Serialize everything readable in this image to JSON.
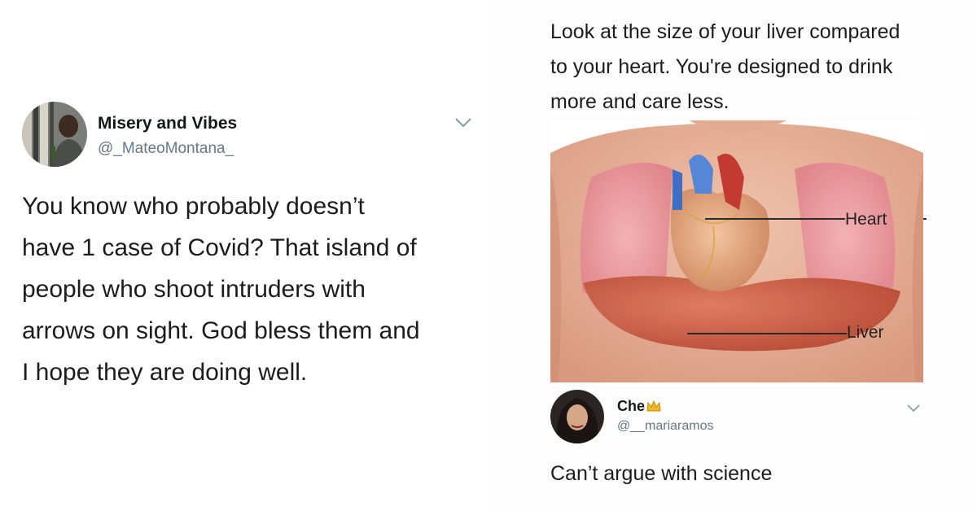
{
  "left_tweet": {
    "display_name": "Misery and Vibes",
    "handle": "@_MateoMontana_",
    "text_lines": [
      "You know who probably doesn’t",
      "have 1 case of Covid? That island of",
      "people who shoot intruders with",
      "arrows on sight. God bless them and",
      "I hope they are doing well."
    ],
    "menu_icon": "chevron-down-icon"
  },
  "right_tweet": {
    "caption_lines": [
      "Look at the size of your liver compared",
      "to your heart. You're designed to drink",
      "more and care less."
    ],
    "diagram_labels": {
      "heart": "Heart",
      "liver": "Liver"
    },
    "reply": {
      "display_name": "Che",
      "name_emoji": "crown-icon",
      "handle": "@__mariaramos",
      "text": "Can’t argue with science",
      "menu_icon": "chevron-down-icon"
    }
  },
  "colors": {
    "text_primary": "#14171a",
    "text_secondary": "#657786",
    "skin": "#e8b49c",
    "lung": "#ec9a9f",
    "liver": "#c9533e"
  }
}
